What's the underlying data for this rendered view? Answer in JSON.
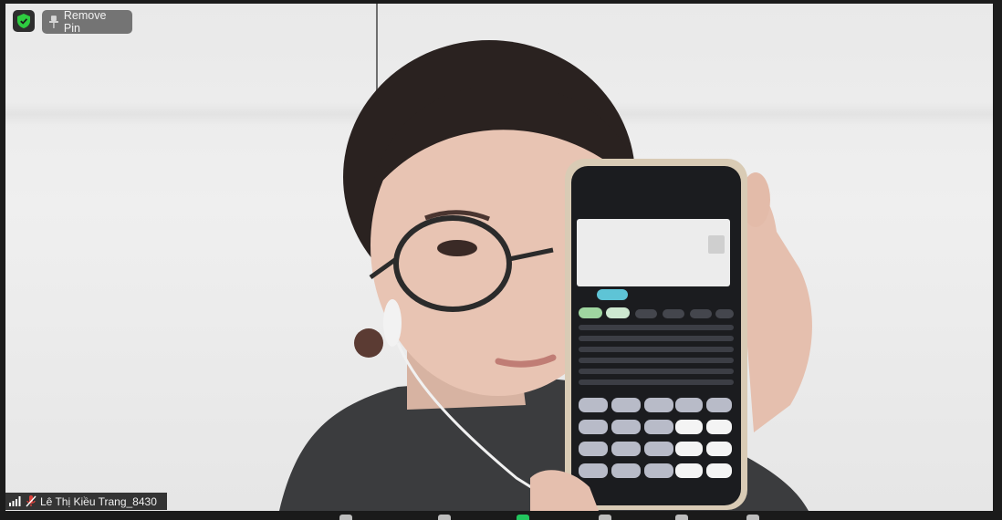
{
  "app": "Zoom meeting",
  "security_badge": {
    "icon": "shield-check-icon",
    "color": "#2ecc40"
  },
  "pin_control": {
    "label": "Remove Pin",
    "icon": "pin-icon"
  },
  "participant": {
    "name": "Lê Thị Kiều Trang_8430",
    "signal_icon": "signal-bars-icon",
    "mic_icon": "mic-muted-icon",
    "mic_color": "#e0413b"
  },
  "toolbar_icons": [
    "participants-icon",
    "share-icon",
    "share-screen-icon",
    "chat-icon",
    "reactions-icon",
    "more-icon"
  ]
}
